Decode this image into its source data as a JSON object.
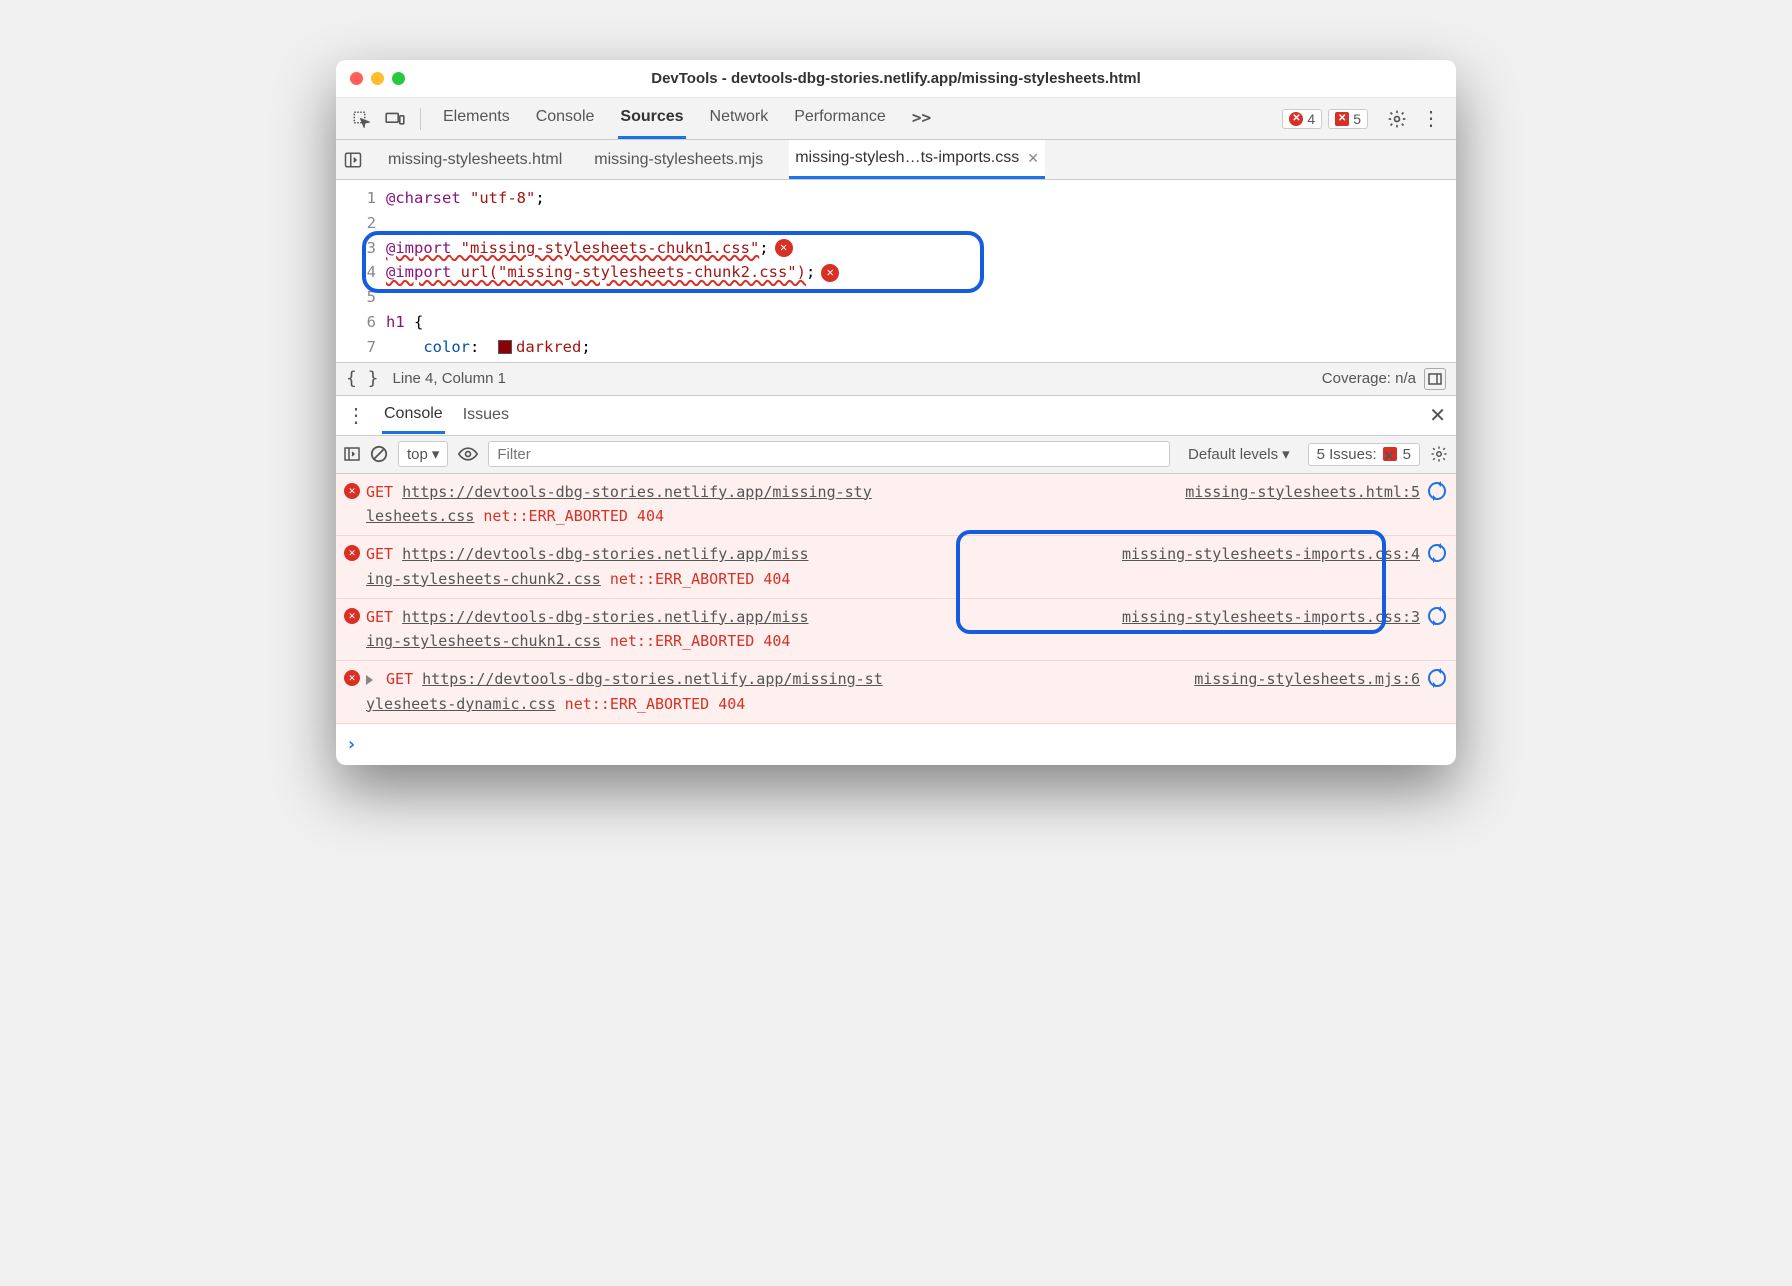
{
  "window": {
    "title": "DevTools - devtools-dbg-stories.netlify.app/missing-stylesheets.html"
  },
  "toolbar": {
    "tabs": [
      "Elements",
      "Console",
      "Sources",
      "Network",
      "Performance"
    ],
    "more": ">>",
    "errors": "4",
    "issues": "5"
  },
  "file_tabs": [
    "missing-stylesheets.html",
    "missing-stylesheets.mjs",
    "missing-stylesh…ts-imports.css"
  ],
  "editor": {
    "lines": {
      "l1": {
        "num": "1",
        "a": "@charset",
        "b": " \"utf-8\"",
        "c": ";"
      },
      "l2": {
        "num": "2"
      },
      "l3": {
        "num": "3",
        "a": "@import",
        "b": " \"missing-stylesheets-chukn1.css\"",
        "c": ";"
      },
      "l4": {
        "num": "4",
        "a": "@import",
        "b": " url(\"missing-stylesheets-chunk2.css\")",
        "c": ";"
      },
      "l5": {
        "num": "5"
      },
      "l6": {
        "num": "6",
        "a": "h1",
        "b": " {"
      },
      "l7": {
        "num": "7",
        "a": "    color",
        "b": ":  ",
        "c": "darkred",
        "d": ";"
      }
    }
  },
  "statusbar": {
    "pos": "Line 4, Column 1",
    "coverage": "Coverage: n/a"
  },
  "drawer": {
    "tabs": [
      "Console",
      "Issues"
    ]
  },
  "console_toolbar": {
    "context": "top",
    "filter_placeholder": "Filter",
    "levels": "Default levels",
    "issues_label": "5 Issues:",
    "issues_count": "5"
  },
  "console_messages": [
    {
      "method": "GET",
      "url_a": "https://devtools-dbg-stories.netlify.app/missing-sty",
      "url_b": "lesheets.css",
      "status": " net::ERR_ABORTED 404",
      "src": "missing-stylesheets.html:5"
    },
    {
      "method": "GET",
      "url_a": "https://devtools-dbg-stories.netlify.app/miss",
      "url_b": "ing-stylesheets-chunk2.css",
      "status": " net::ERR_ABORTED 404",
      "src": "missing-stylesheets-imports.css:4"
    },
    {
      "method": "GET",
      "url_a": "https://devtools-dbg-stories.netlify.app/miss",
      "url_b": "ing-stylesheets-chukn1.css",
      "status": " net::ERR_ABORTED 404",
      "src": "missing-stylesheets-imports.css:3"
    },
    {
      "method": "GET",
      "url_a": "https://devtools-dbg-stories.netlify.app/missing-st",
      "url_b": "ylesheets-dynamic.css",
      "status": " net::ERR_ABORTED 404",
      "src": "missing-stylesheets.mjs:6",
      "expandable": true
    }
  ]
}
